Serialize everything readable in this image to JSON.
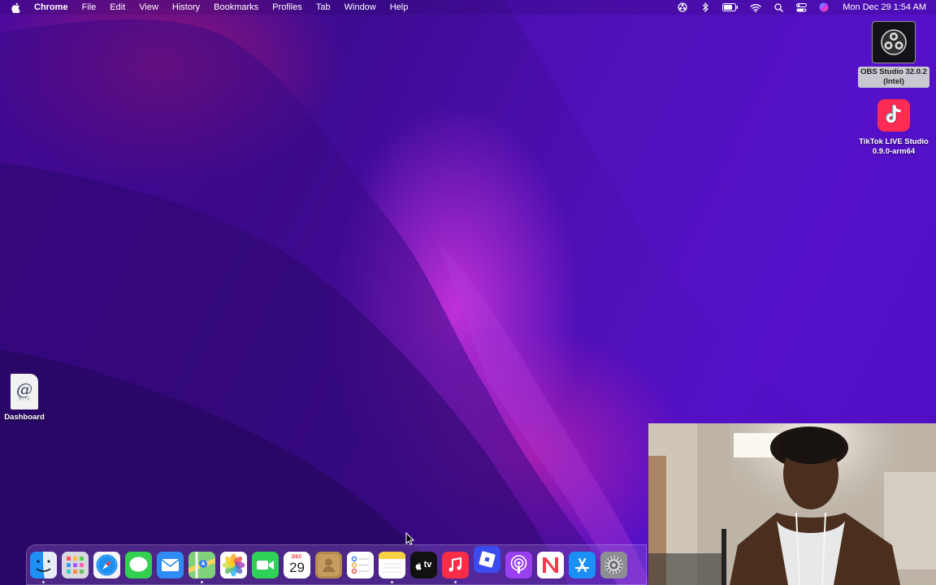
{
  "menubar": {
    "app_name": "Chrome",
    "items": [
      "File",
      "Edit",
      "View",
      "History",
      "Bookmarks",
      "Profiles",
      "Tab",
      "Window",
      "Help"
    ],
    "clock": "Mon Dec 29  1:54 AM",
    "status_icons": [
      "obs-status-icon",
      "bluetooth-icon",
      "battery-icon",
      "wifi-icon",
      "spotlight-search-icon",
      "control-center-icon",
      "siri-icon"
    ]
  },
  "desktop": {
    "obs": {
      "label_line1": "OBS Studio 32.0.2",
      "label_line2": "(Intel)"
    },
    "tiktok": {
      "label_line1": "TikTok LIVE Studio",
      "label_line2": "0.9.0-arm64"
    },
    "dashboard": {
      "label": "Dashboard",
      "file_ext": "HTTP"
    }
  },
  "dock": {
    "apps": [
      "finder",
      "launchpad",
      "safari",
      "messages",
      "mail",
      "maps",
      "photos",
      "facetime",
      "calendar",
      "contacts",
      "reminders",
      "notes",
      "apple-tv",
      "music",
      "roblox",
      "podcasts",
      "news",
      "app-store",
      "system-settings"
    ],
    "calendar": {
      "month": "DEC",
      "day": "29"
    },
    "tv_label": "tv"
  },
  "colors": {
    "wallpaper_base": "#4a0aa0",
    "tiktok_red": "#fe2c55",
    "dock_tint": "rgba(160,120,220,0.28)"
  }
}
